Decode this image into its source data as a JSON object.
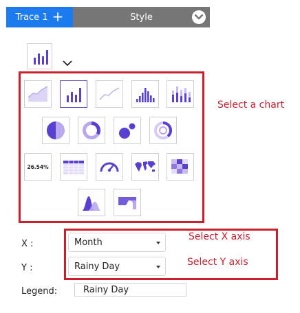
{
  "tabs": {
    "trace_label": "Trace 1",
    "trace_add": "+",
    "style_label": "Style"
  },
  "notes": {
    "select_chart": "Select a chart",
    "select_x": "Select X axis",
    "select_y": "Select Y axis"
  },
  "tiles": {
    "indicator_text": "26.54%"
  },
  "axes": {
    "x_label": "X :",
    "x_value": "Month",
    "y_label": "Y :",
    "y_value": "Rainy Day"
  },
  "legend": {
    "label": "Legend:",
    "value": "Rainy Day"
  },
  "colors": {
    "accent_purple": "#5a3fd3",
    "light_purple": "#b9a7ef",
    "highlight_red": "#cc1e2c",
    "tab_blue": "#1d7bf0",
    "tab_gray": "#767676"
  }
}
